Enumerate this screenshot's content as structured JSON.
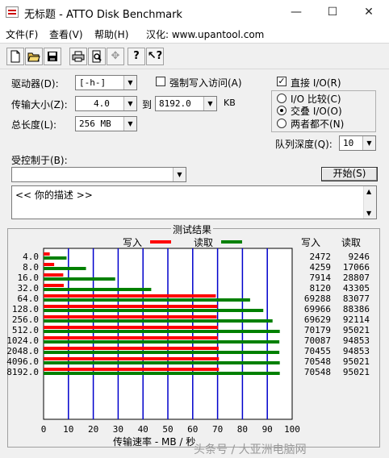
{
  "window": {
    "title": "无标题 - ATTO Disk Benchmark",
    "min_glyph": "—",
    "max_glyph": "☐",
    "close_glyph": "✕"
  },
  "menu": {
    "file": "文件(F)",
    "view": "查看(V)",
    "help": "帮助(H)",
    "localized": "汉化: www.upantool.com"
  },
  "toolbar": {
    "icons": [
      "new-file-icon",
      "open-folder-icon",
      "save-icon",
      "print-icon",
      "print-preview-icon",
      "move-icon",
      "help-icon",
      "context-help-icon"
    ]
  },
  "form": {
    "drive_label": "驱动器(D):",
    "drive_value": "[-h-]",
    "transfer_label": "传输大小(Z):",
    "transfer_from": "4.0",
    "to_label": "到",
    "transfer_to": "8192.0",
    "kb_label": "KB",
    "length_label": "总长度(L):",
    "length_value": "256 MB",
    "force_write_label": "强制写入访问(A)",
    "force_write_checked": false,
    "direct_io_label": "直接 I/O(R)",
    "direct_io_checked": true,
    "io_compare_label": "I/O 比较(C)",
    "overlap_io_label": "交叠 I/O(O)",
    "neither_label": "两者都不(N)",
    "selected_io": "overlap",
    "queue_label": "队列深度(Q):",
    "queue_value": "10",
    "controlled_label": "受控制于(B):",
    "controlled_value": "",
    "start_label": "开始(S)",
    "description": "<<  你的描述  >>"
  },
  "results": {
    "title": "测试结果",
    "write_legend": "写入",
    "read_legend": "读取",
    "write_col": "写入",
    "read_col": "读取",
    "write_color": "#ff0000",
    "read_color": "#008000",
    "grid_color": "#0000cc",
    "xlabel": "传输速率 - MB / 秒",
    "x_ticks": [
      "0",
      "10",
      "20",
      "30",
      "40",
      "50",
      "60",
      "70",
      "80",
      "90",
      "100"
    ],
    "rows": [
      {
        "size": "4.0",
        "write": "2472",
        "read": "9246"
      },
      {
        "size": "8.0",
        "write": "4259",
        "read": "17066"
      },
      {
        "size": "16.0",
        "write": "7914",
        "read": "28807"
      },
      {
        "size": "32.0",
        "write": "8120",
        "read": "43305"
      },
      {
        "size": "64.0",
        "write": "69288",
        "read": "83077"
      },
      {
        "size": "128.0",
        "write": "69966",
        "read": "88386"
      },
      {
        "size": "256.0",
        "write": "69629",
        "read": "92114"
      },
      {
        "size": "512.0",
        "write": "70179",
        "read": "95021"
      },
      {
        "size": "1024.0",
        "write": "70087",
        "read": "94853"
      },
      {
        "size": "2048.0",
        "write": "70455",
        "read": "94853"
      },
      {
        "size": "4096.0",
        "write": "70548",
        "read": "95021"
      },
      {
        "size": "8192.0",
        "write": "70548",
        "read": "95021"
      }
    ]
  },
  "watermark": "头条号 / 大亚洲电脑网"
}
